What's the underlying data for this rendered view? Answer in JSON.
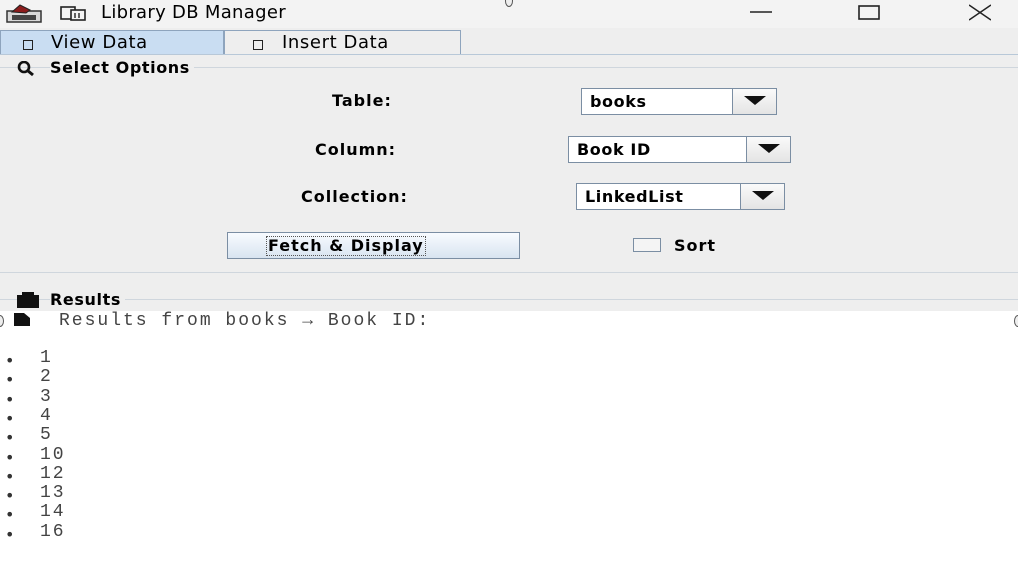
{
  "window": {
    "title": "Library DB Manager",
    "icon_names": [
      "app-icon",
      "window-glyph-icon"
    ],
    "controls": {
      "minimize": "minimize-icon",
      "maximize": "maximize-icon",
      "close": "close-icon"
    }
  },
  "tabs": [
    {
      "label": "View Data",
      "selected": true,
      "icon": "checkbox-square-icon"
    },
    {
      "label": "Insert Data",
      "selected": false,
      "icon": "checkbox-square-icon"
    }
  ],
  "options": {
    "title": "Select Options",
    "icon": "search-icon",
    "table_label": "Table:",
    "table_value": "books",
    "column_label": "Column:",
    "column_value": "Book ID",
    "collection_label": "Collection:",
    "collection_value": "LinkedList",
    "fetch_label": "Fetch & Display",
    "sort_label": "Sort",
    "sort_checked": false
  },
  "results": {
    "title": "Results",
    "icon": "clipboard-icon",
    "header": "Results from books → Book ID:",
    "bullet": "•",
    "items": [
      "1",
      "2",
      "3",
      "4",
      "5",
      "10",
      "12",
      "13",
      "14",
      "16"
    ]
  },
  "colors": {
    "window_bg": "#eeeeee",
    "selected_tab": "#c9ddf2",
    "border": "#7b8ea3",
    "results_bg": "#ffffff"
  }
}
